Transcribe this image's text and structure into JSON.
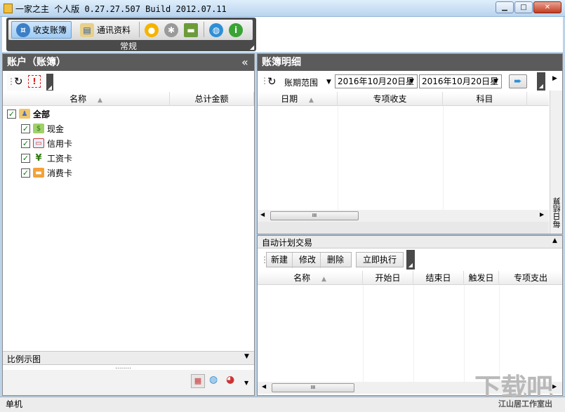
{
  "window": {
    "title": "一家之主 个人版 0.27.27.507 Build 2012.07.11",
    "min_label": "▁",
    "max_label": "□",
    "close_label": "✕"
  },
  "toolbar": {
    "ledger_label": "收支账簿",
    "contacts_label": "通讯资料",
    "group_label": "常规",
    "icons": [
      "ledger-icon",
      "contacts-icon",
      "bulb-icon",
      "gear-icon",
      "sign-icon",
      "globe-icon",
      "info-icon"
    ]
  },
  "accounts": {
    "header": "账户（账簿）",
    "collapse": "«",
    "col_name": "名称",
    "col_total": "总计金额",
    "sort_indicator": "▲",
    "items": [
      {
        "label": "全部",
        "checked": true,
        "bold": true,
        "icon": "all-accounts-icon"
      },
      {
        "label": "现金",
        "checked": true,
        "icon": "cash-icon"
      },
      {
        "label": "信用卡",
        "checked": true,
        "icon": "credit-card-icon"
      },
      {
        "label": "工资卡",
        "checked": true,
        "icon": "salary-card-icon"
      },
      {
        "label": "消费卡",
        "checked": true,
        "icon": "consumer-card-icon"
      }
    ],
    "chart_label": "比例示图",
    "grip": "........"
  },
  "ledger": {
    "header": "账簿明细",
    "range_label": "账期范围",
    "date_from": "2016年10月20日星",
    "date_to": "2016年10月20日星",
    "columns": [
      "日期",
      "专项收支",
      "科目"
    ],
    "side_tab": "每日结算",
    "scroll_grip": "III"
  },
  "auto": {
    "header": "自动计划交易",
    "buttons": [
      "新建",
      "修改",
      "删除"
    ],
    "execute": "立即执行",
    "columns": [
      "名称",
      "开始日",
      "结束日",
      "触发日",
      "专项支出"
    ],
    "scroll_grip": "III"
  },
  "status": {
    "mode": "单机",
    "watermark": "下载吧",
    "watermark_sub": "江山居工作室出"
  },
  "colors": {
    "accent": "#6c9fd0",
    "header_bg": "#5b5b5b",
    "check": "#137a13"
  }
}
